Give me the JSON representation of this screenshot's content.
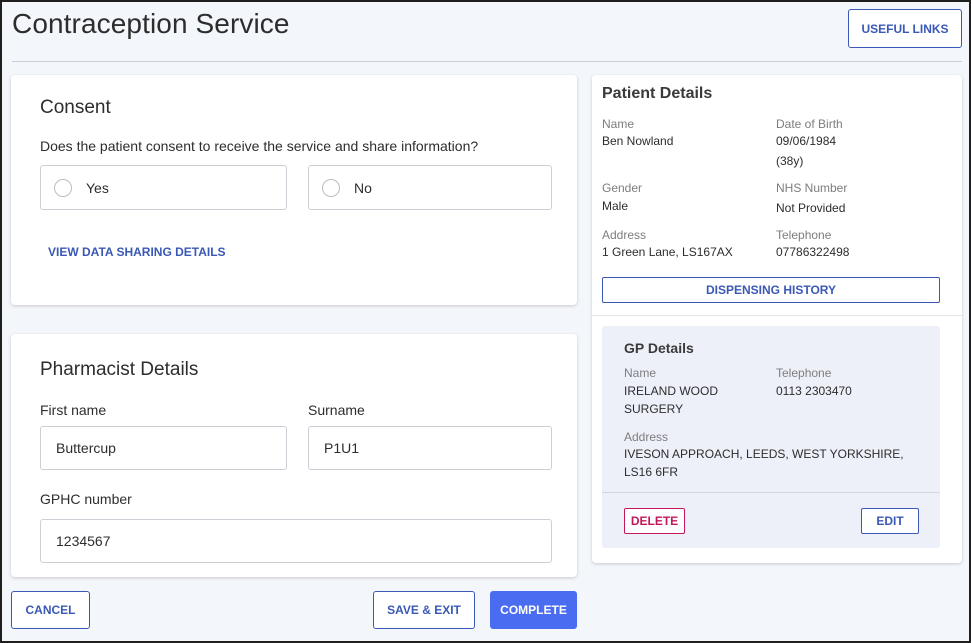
{
  "header": {
    "title": "Contraception Service",
    "useful_links_label": "USEFUL LINKS"
  },
  "consent": {
    "title": "Consent",
    "question": "Does the patient consent to receive the service and share information?",
    "options": [
      {
        "label": "Yes",
        "selected": false
      },
      {
        "label": "No",
        "selected": false
      }
    ],
    "view_details_label": "VIEW DATA SHARING DETAILS"
  },
  "pharmacist": {
    "title": "Pharmacist Details",
    "first_name_label": "First name",
    "first_name_value": "Buttercup",
    "surname_label": "Surname",
    "surname_value": "P1U1",
    "gphc_label": "GPHC number",
    "gphc_value": "1234567"
  },
  "patient": {
    "title": "Patient Details",
    "name_label": "Name",
    "name_value": "Ben Nowland",
    "dob_label": "Date of Birth",
    "dob_value": "09/06/1984",
    "age_value": "(38y)",
    "gender_label": "Gender",
    "gender_value": "Male",
    "nhs_label": "NHS Number",
    "nhs_value": "Not Provided",
    "address_label": "Address",
    "address_value": "1 Green Lane, LS167AX",
    "telephone_label": "Telephone",
    "telephone_value": "07786322498",
    "dispensing_history_label": "DISPENSING HISTORY"
  },
  "gp": {
    "title": "GP Details",
    "name_label": "Name",
    "name_line1": "IRELAND WOOD",
    "name_line2": "SURGERY",
    "telephone_label": "Telephone",
    "telephone_value": "0113 2303470",
    "address_label": "Address",
    "address_line1": "IVESON APPROACH, LEEDS, WEST YORKSHIRE,",
    "address_line2": "LS16 6FR",
    "delete_label": "DELETE",
    "edit_label": "EDIT"
  },
  "footer": {
    "cancel_label": "CANCEL",
    "save_exit_label": "SAVE & EXIT",
    "complete_label": "COMPLETE"
  },
  "colors": {
    "accent": "#3a58b5",
    "primary_button": "#4a6cf0",
    "danger": "#c2185b",
    "page_background": "#f3f6fb",
    "gp_panel_background": "#edf0f9"
  }
}
